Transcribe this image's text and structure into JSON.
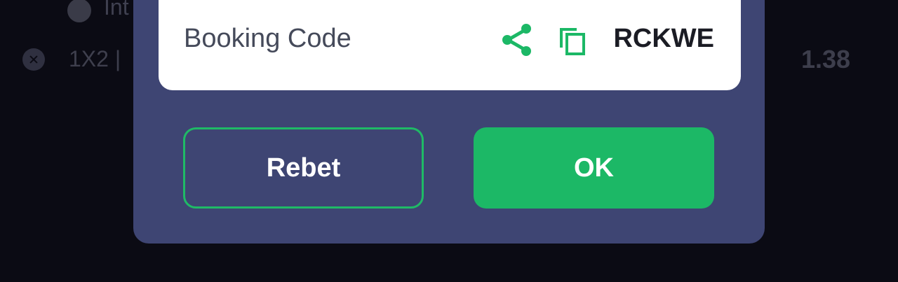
{
  "background": {
    "partial_text": "Int",
    "market": "1X2 |",
    "odds": "1.38"
  },
  "modal": {
    "booking_label": "Booking Code",
    "booking_code": "RCKWE",
    "share_icon": "share-icon",
    "copy_icon": "copy-icon",
    "rebet_label": "Rebet",
    "ok_label": "OK"
  },
  "colors": {
    "accent": "#1cb866",
    "modal_bg": "#3e4573",
    "page_bg": "#0b0b14"
  }
}
